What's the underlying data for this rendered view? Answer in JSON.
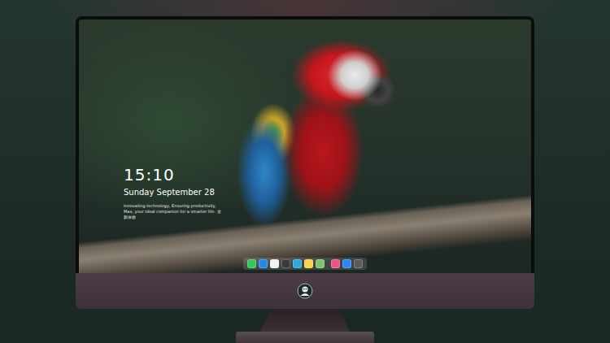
{
  "lock_screen": {
    "time": "15:10",
    "date": "Sunday September 28",
    "tagline": "Innovating technology, Ensuring productivity, Max, your ideal companion for a smarter life. 全新体验"
  },
  "dock": {
    "groups": [
      [
        {
          "color": "#34c759"
        },
        {
          "color": "#1e88e5"
        },
        {
          "color": "#f2f2f2"
        },
        {
          "color": "#3a3a3c"
        },
        {
          "color": "#2aa8e0"
        },
        {
          "color": "#f5d547"
        },
        {
          "color": "#7dc36b"
        }
      ],
      [
        {
          "color": "#f0508a"
        },
        {
          "color": "#2a86f0"
        },
        {
          "color": "#5a5a5e"
        }
      ]
    ]
  }
}
